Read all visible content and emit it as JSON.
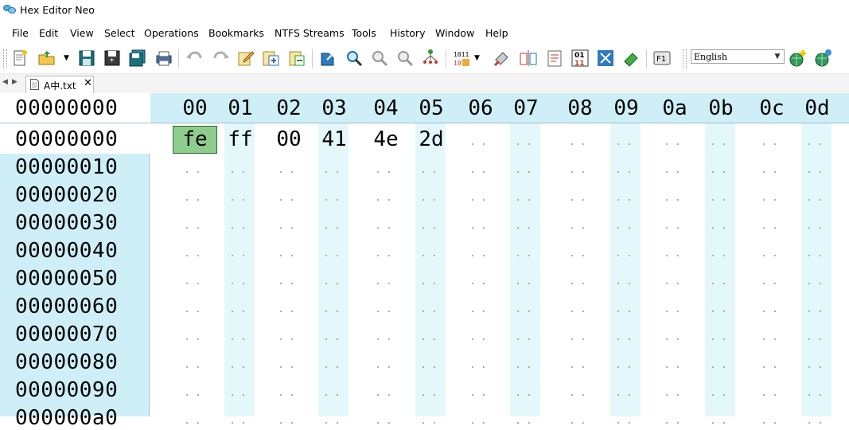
{
  "window": {
    "title": "Hex Editor Neo",
    "logo_icon": "butterfly-logo-icon"
  },
  "menu": [
    {
      "label": "File"
    },
    {
      "label": "Edit"
    },
    {
      "label": "View"
    },
    {
      "label": "Select"
    },
    {
      "label": "Operations"
    },
    {
      "label": "Bookmarks"
    },
    {
      "label": "NTFS Streams"
    },
    {
      "label": "Tools"
    },
    {
      "label": "History"
    },
    {
      "label": "Window"
    },
    {
      "label": "Help"
    }
  ],
  "toolbar": {
    "language": "English",
    "icons": [
      "new-file-icon",
      "open-folder-icon",
      "save-icon",
      "save-as-icon",
      "save-all-icon",
      "print-icon",
      "undo-icon",
      "redo-icon",
      "edit-note-icon",
      "copy-icon",
      "paste-icon",
      "export-icon",
      "find-icon",
      "find-next-icon",
      "find-prev-icon",
      "hierarchy-icon",
      "bits-icon",
      "binary-01-icon",
      "fullscreen-icon",
      "eraser-icon",
      "bookmark-icon",
      "compare-icon",
      "clipboard-icon",
      "keyboard-f1-icon",
      "globe-add-icon",
      "globe-icon"
    ]
  },
  "tab": {
    "label": "A中.txt",
    "close": "✕"
  },
  "editor": {
    "offset_header": "00000000",
    "columns": [
      "00",
      "01",
      "02",
      "03",
      "04",
      "05",
      "06",
      "07",
      "08",
      "09",
      "0a",
      "0b",
      "0c",
      "0d"
    ],
    "offsets": [
      "00000000",
      "00000010",
      "00000020",
      "00000030",
      "00000040",
      "00000050",
      "00000060",
      "00000070",
      "00000080",
      "00000090",
      "000000a0"
    ],
    "first_row": [
      "fe",
      "ff",
      "00",
      "41",
      "4e",
      "2d"
    ],
    "empty_cell": "..",
    "selected_cell": "fe"
  },
  "colors": {
    "offset_bg": "#cfeff8",
    "stripe": "#e4f8fc",
    "selection": "#8fcd8f"
  }
}
